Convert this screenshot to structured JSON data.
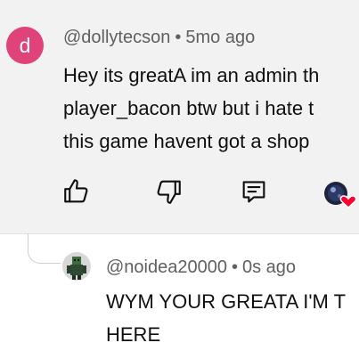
{
  "comment": {
    "avatar_letter": "d",
    "author": "@dollytecson",
    "separator": "•",
    "time": "5mo ago",
    "lines": [
      "Hey its greatA im an admin th",
      "player_bacon btw but i hate t",
      "this game havent got a shop"
    ],
    "actions": {
      "like_icon": "thumbs-up-icon",
      "dislike_icon": "thumbs-down-icon",
      "reply_icon": "reply-icon",
      "creator_heart_icon": "creator-heart-icon"
    }
  },
  "reply": {
    "author": "@noidea20000",
    "separator": "•",
    "time": "0s ago",
    "lines": [
      "WYM YOUR GREATA I'M T",
      "HERE"
    ]
  },
  "colors": {
    "comment_bg": "#f2f2f2",
    "avatar_bg": "#e0427a",
    "heart": "#ff0033",
    "meta_text": "#606060",
    "body_text": "#0f0f0f"
  }
}
